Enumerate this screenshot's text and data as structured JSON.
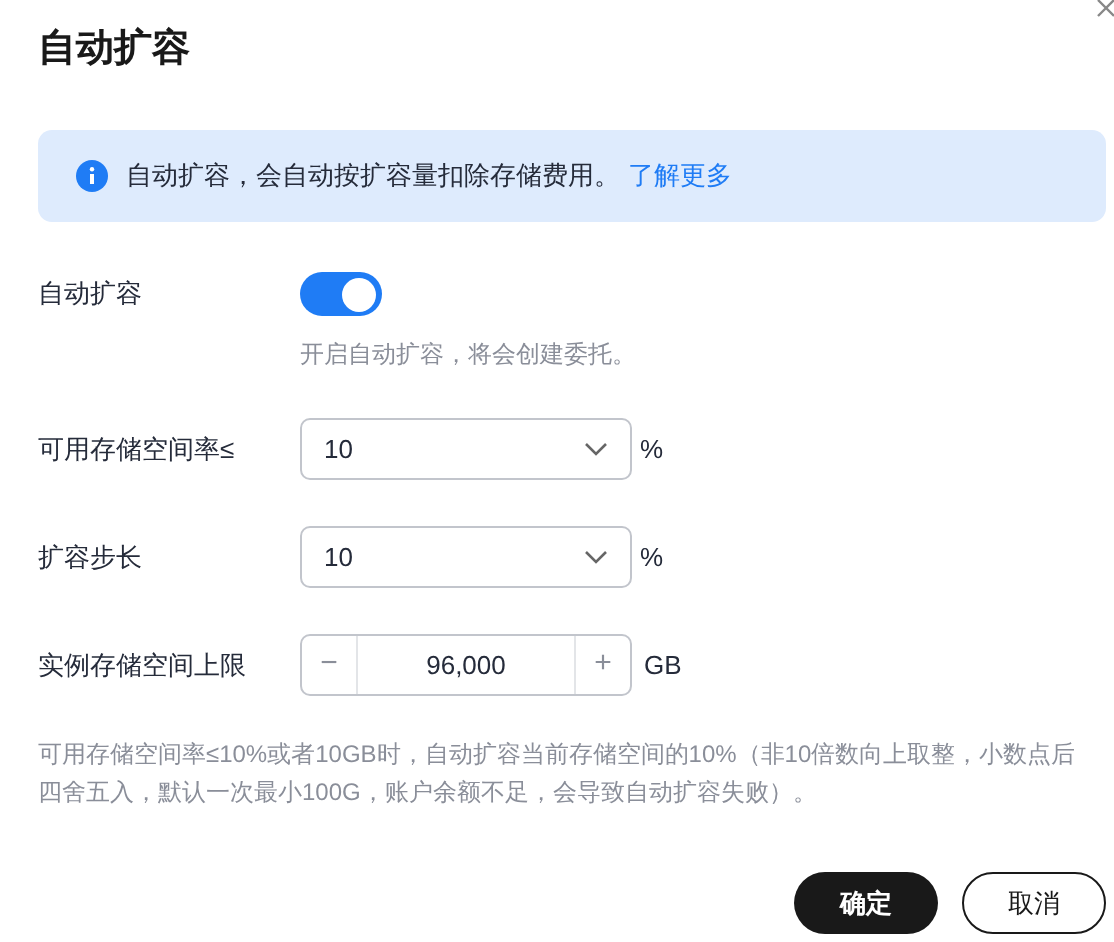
{
  "dialog": {
    "title": "自动扩容"
  },
  "banner": {
    "text": "自动扩容，会自动按扩容量扣除存储费用。",
    "link": "了解更多"
  },
  "form": [
    {
      "kind": "switch",
      "label": "自动扩容",
      "on": true,
      "hint": "开启自动扩容，将会创建委托。"
    },
    {
      "kind": "select",
      "label": "可用存储空间率≤",
      "value": "10",
      "unit": "%"
    },
    {
      "kind": "select",
      "label": "扩容步长",
      "value": "10",
      "unit": "%"
    },
    {
      "kind": "number",
      "label": "实例存储空间上限",
      "value": "96,000",
      "minus": "−",
      "plus": "+",
      "unit": "GB"
    }
  ],
  "note": "可用存储空间率≤10%或者10GB时，自动扩容当前存储空间的10%（非10倍数向上取整，小数点后四舍五入，默认一次最小100G，账户余额不足，会导致自动扩容失败）。",
  "buttons": [
    {
      "kind": "primary",
      "label": "确定"
    },
    {
      "kind": "secondary",
      "label": "取消"
    }
  ]
}
